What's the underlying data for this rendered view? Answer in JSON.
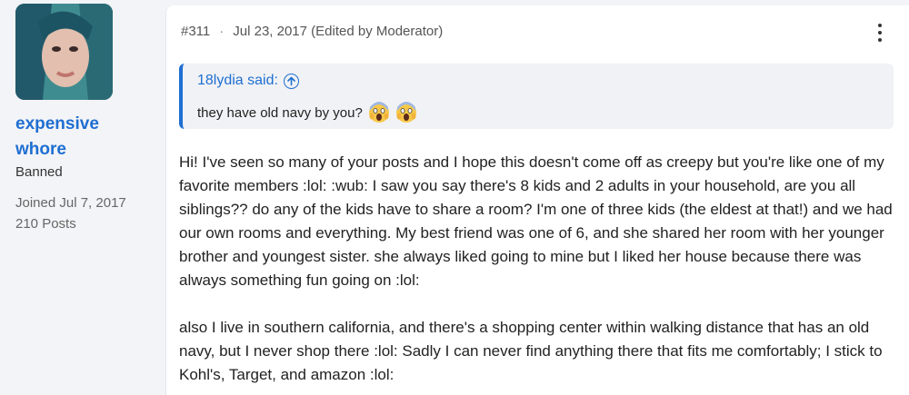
{
  "author": {
    "name": "expensive whore",
    "role": "Banned",
    "joined": "Joined Jul 7, 2017",
    "posts": "210 Posts"
  },
  "post": {
    "number": "#311",
    "separator": "·",
    "date": "Jul 23, 2017 (Edited by Moderator)",
    "quote": {
      "author": "18lydia said:",
      "text": "they have old navy by you?",
      "emojis": [
        "scream-emoji",
        "scream-emoji"
      ]
    },
    "paragraphs": [
      "Hi! I've seen so many of your posts and I hope this doesn't come off as creepy but you're like one of my favorite members :lol: :wub: I saw you say there's 8 kids and 2 adults in your household, are you all siblings?? do any of the kids have to share a room? I'm one of three kids (the eldest at that!) and we had our own rooms and everything. My best friend was one of 6, and she shared her room with her younger brother and youngest sister. she always liked going to mine but I liked her house because there was always something fun going on :lol:",
      "also I live in southern california, and there's a shopping center within walking distance that has an old navy, but I never shop there :lol: Sadly I can never find anything there that fits me comfortably; I stick to Kohl's, Target, and amazon :lol:"
    ]
  },
  "colors": {
    "accent": "#1f6fd1",
    "page_bg": "#f3f4f7",
    "quote_bg": "#f1f2f5"
  }
}
